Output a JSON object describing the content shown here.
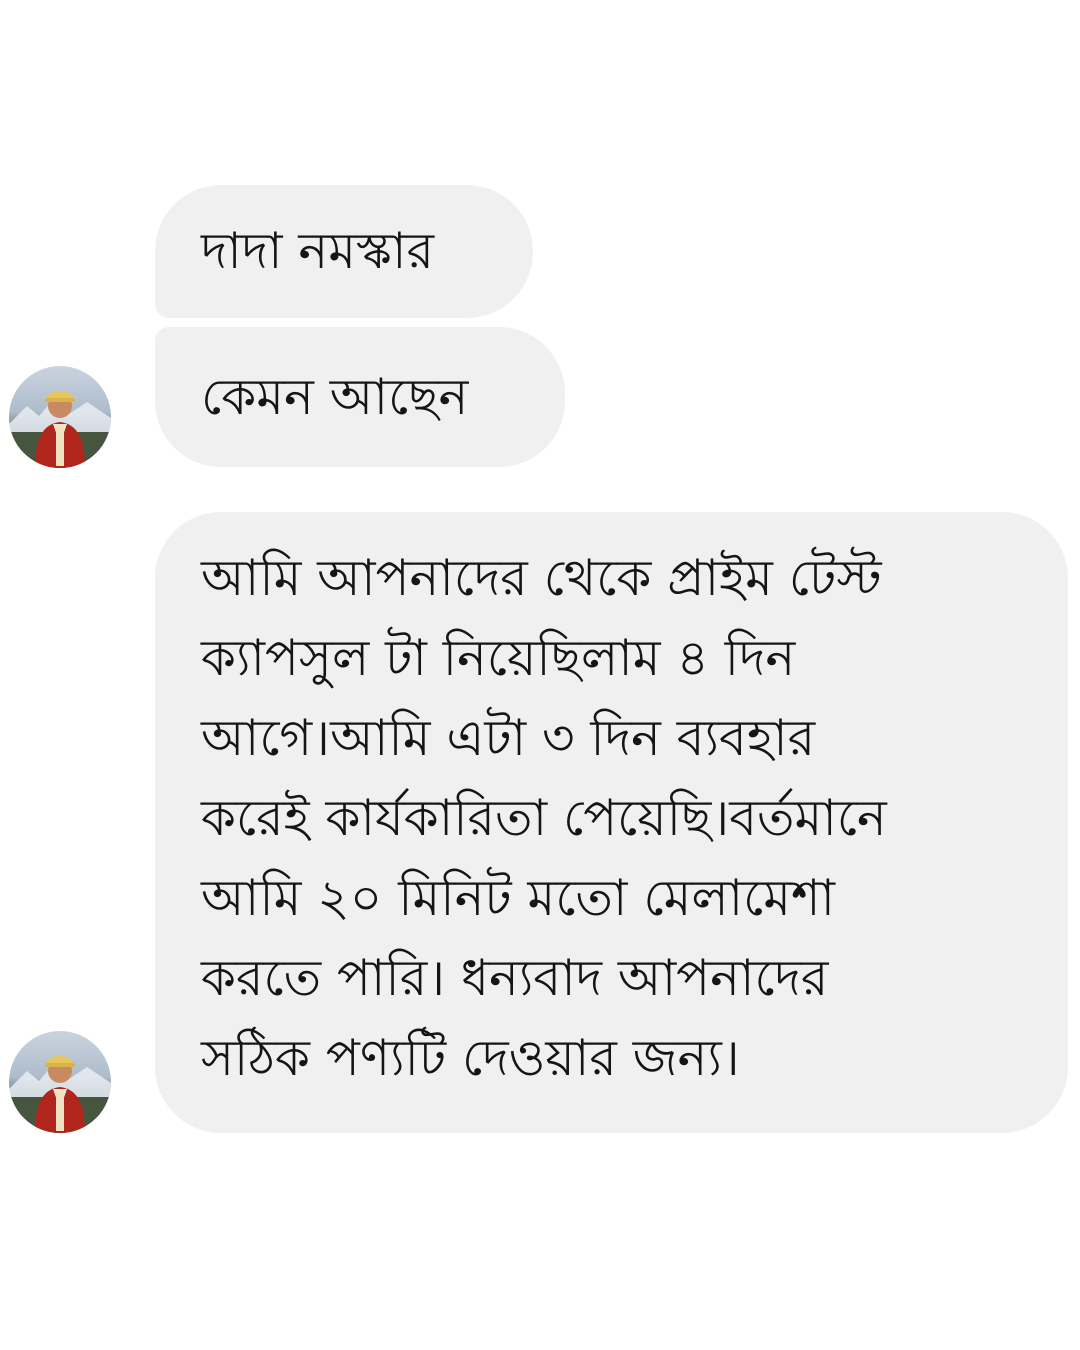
{
  "messages": [
    {
      "text": "দাদা নমস্কার"
    },
    {
      "text": "কেমন আছেন"
    },
    {
      "lines": [
        "আমি আপনাদের থেকে প্রাইম টেস্ট",
        "ক্যাপসুল টা নিয়েছিলাম ৪ দিন",
        "আগে।আমি এটা ৩ দিন ব্যবহার",
        "করেই কার্যকারিতা পেয়েছি।বর্তমানে",
        "আমি ২০ মিনিট মতো মেলামেশা",
        "করতে পারি। ধন্যবাদ আপনাদের",
        "সঠিক পণ্যটি দেওয়ার জন্য।"
      ]
    }
  ],
  "colors": {
    "background": "#ffffff",
    "bubble": "#f0f0f0",
    "text": "#151515"
  },
  "icons": {
    "avatar": "sender-avatar-photo"
  }
}
